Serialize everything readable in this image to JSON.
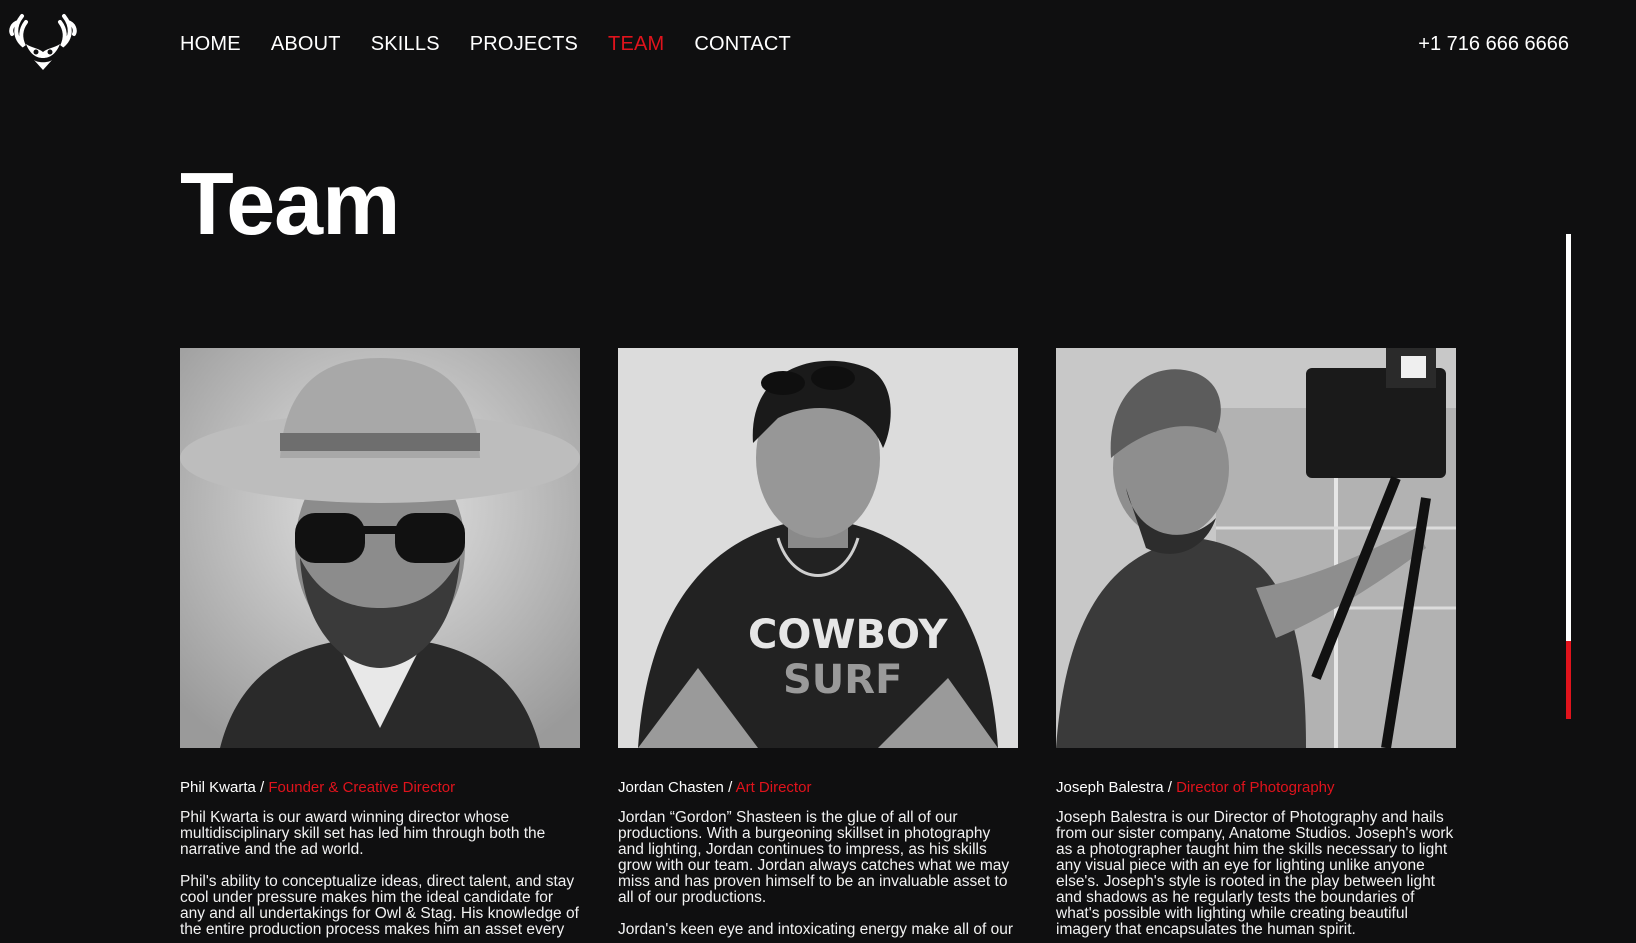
{
  "nav": {
    "items": [
      {
        "label": "HOME"
      },
      {
        "label": "ABOUT"
      },
      {
        "label": "SKILLS"
      },
      {
        "label": "PROJECTS"
      },
      {
        "label": "TEAM",
        "active": true
      },
      {
        "label": "CONTACT"
      }
    ],
    "phone": "+1 716 666 6666"
  },
  "page": {
    "title": "Team"
  },
  "scroll": {
    "progress": 0.16
  },
  "colors": {
    "accent": "#e0131c",
    "background": "#0f0f10",
    "text": "#ffffff"
  },
  "icons": {
    "logo": "owl-stag-logo-icon"
  },
  "team": [
    {
      "name": "Phil Kwarta",
      "separator": " / ",
      "role": "Founder & Creative Director",
      "bio": [
        "Phil Kwarta is our award winning director whose multidisciplinary skill set has led him through both the narrative and the ad world.",
        "Phil's ability to conceptualize ideas, direct talent, and stay cool under pressure makes him the ideal candidate for any and all undertakings for Owl & Stag. His knowledge of the entire production process makes him an asset every"
      ]
    },
    {
      "name": "Jordan Chasten",
      "separator": " / ",
      "role": "Art Director",
      "bio": [
        "Jordan “Gordon” Shasteen is the glue of all of our productions. With a burgeoning skillset in photography and lighting, Jordan continues to impress, as his skills grow with our team. Jordan always catches what we may miss and has proven himself to be an invaluable asset to all of our productions.",
        "Jordan's keen eye and intoxicating energy make all of our"
      ]
    },
    {
      "name": "Joseph Balestra",
      "separator": " / ",
      "role": "Director of Photography",
      "bio": [
        "Joseph Balestra is our Director of Photography and hails from our sister company, Anatome Studios. Joseph's work as a photographer taught him the skills necessary to light any visual piece with an eye for lighting unlike anyone else's. Joseph's style is rooted in the play between light and shadows as he regularly tests the boundaries of what's possible with lighting while creating beautiful imagery that encapsulates the human spirit."
      ]
    }
  ]
}
